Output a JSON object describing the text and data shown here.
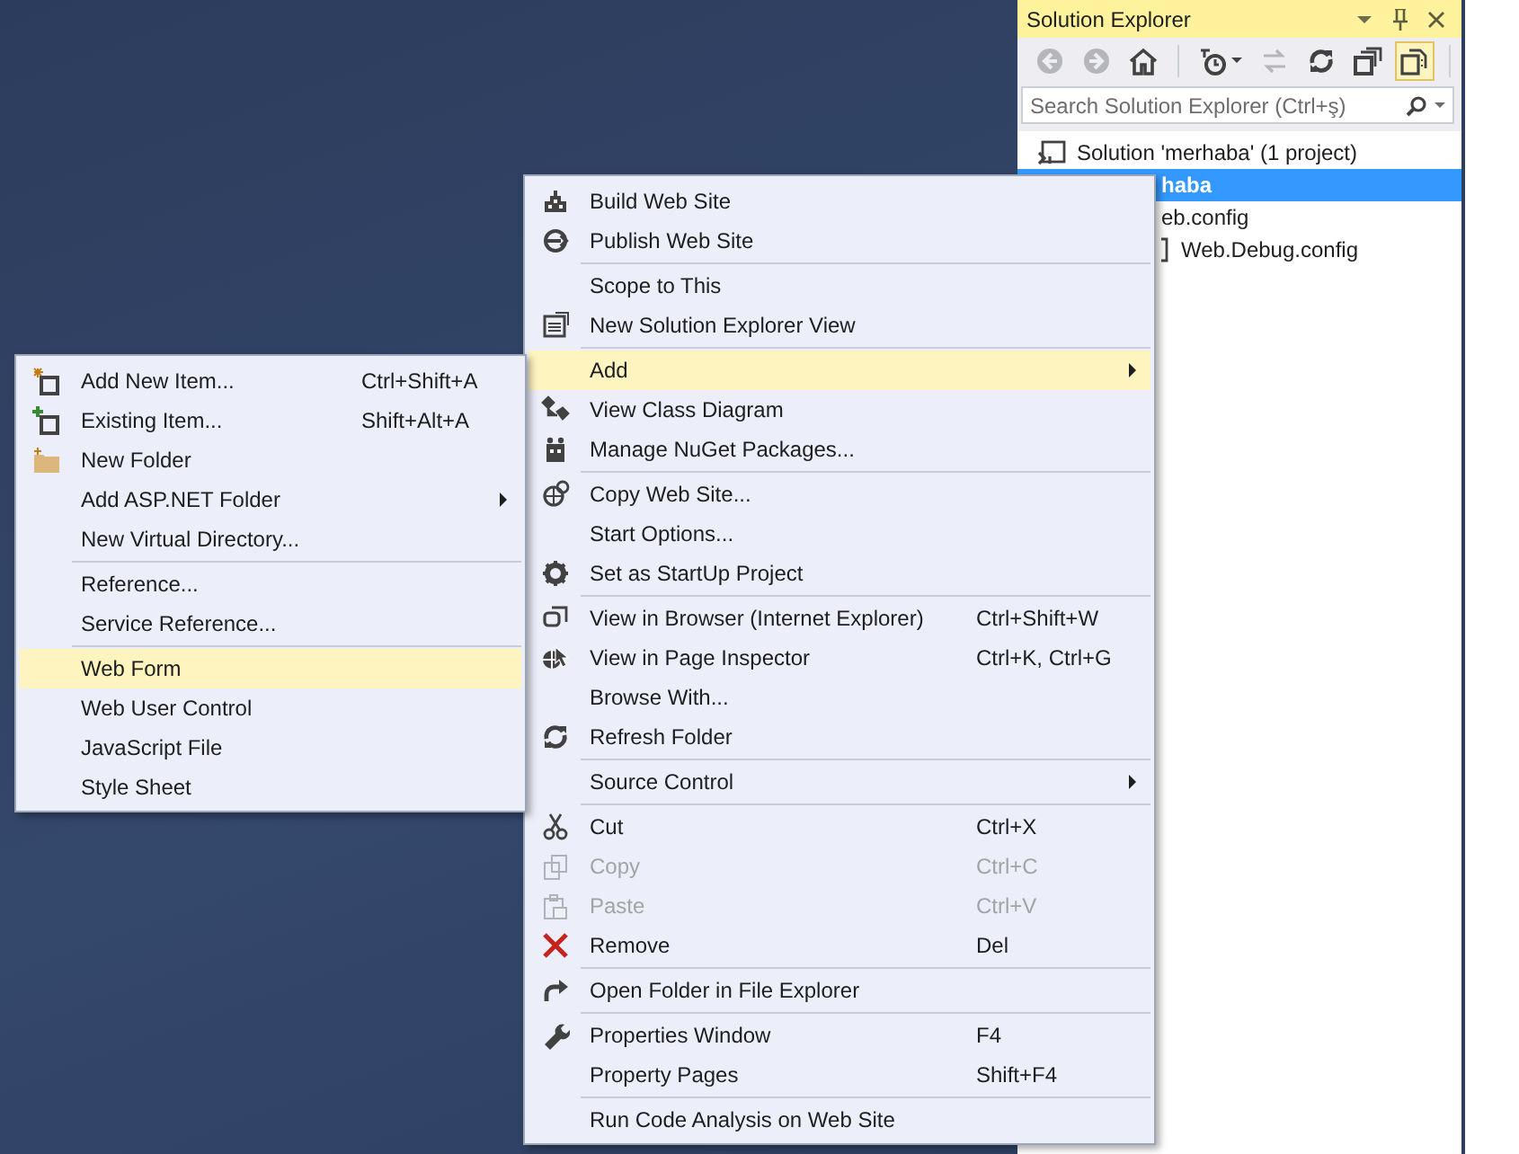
{
  "solution_explorer": {
    "title": "Solution Explorer",
    "toolbar": [
      {
        "disabled": true,
        "pressed": false
      },
      {
        "disabled": true,
        "pressed": false
      },
      {
        "disabled": false,
        "pressed": false
      },
      {
        "disabled": false,
        "pressed": false
      },
      {
        "disabled": true,
        "pressed": false
      },
      {
        "disabled": false,
        "pressed": false
      },
      {
        "disabled": false,
        "pressed": false
      },
      {
        "disabled": false,
        "pressed": true
      }
    ],
    "search": {
      "placeholder": "Search Solution Explorer (Ctrl+ş)"
    },
    "tree": [
      {
        "label": "Solution 'merhaba' (1 project)",
        "selected": false,
        "children": [
          {
            "label": "haba",
            "selected": true,
            "children": [
              {
                "label": "eb.config",
                "selected": false,
                "children": [
                  {
                    "label": "Web.Debug.config",
                    "selected": false
                  }
                ]
              }
            ]
          }
        ]
      }
    ]
  },
  "context_menu": {
    "sections": [
      [
        {
          "label": "Build Web Site",
          "disabled": false,
          "selected": false,
          "has_submenu": false
        },
        {
          "label": "Publish Web Site",
          "disabled": false,
          "selected": false,
          "has_submenu": false
        }
      ],
      [
        {
          "label": "Scope to This",
          "disabled": false,
          "selected": false,
          "has_submenu": false
        },
        {
          "label": "New Solution Explorer View",
          "disabled": false,
          "selected": false,
          "has_submenu": false
        }
      ],
      [
        {
          "label": "Add",
          "disabled": false,
          "selected": true,
          "has_submenu": true
        },
        {
          "label": "View Class Diagram",
          "disabled": false,
          "selected": false,
          "has_submenu": false
        },
        {
          "label": "Manage NuGet Packages...",
          "disabled": false,
          "selected": false,
          "has_submenu": false
        }
      ],
      [
        {
          "label": "Copy Web Site...",
          "disabled": false,
          "selected": false,
          "has_submenu": false
        },
        {
          "label": "Start Options...",
          "disabled": false,
          "selected": false,
          "has_submenu": false
        },
        {
          "label": "Set as StartUp Project",
          "disabled": false,
          "selected": false,
          "has_submenu": false
        }
      ],
      [
        {
          "label": "View in Browser (Internet Explorer)",
          "shortcut": "Ctrl+Shift+W",
          "disabled": false,
          "selected": false,
          "has_submenu": false
        },
        {
          "label": "View in Page Inspector",
          "shortcut": "Ctrl+K, Ctrl+G",
          "disabled": false,
          "selected": false,
          "has_submenu": false
        },
        {
          "label": "Browse With...",
          "disabled": false,
          "selected": false,
          "has_submenu": false
        },
        {
          "label": "Refresh Folder",
          "disabled": false,
          "selected": false,
          "has_submenu": false
        }
      ],
      [
        {
          "label": "Source Control",
          "disabled": false,
          "selected": false,
          "has_submenu": true
        }
      ],
      [
        {
          "label": "Cut",
          "shortcut": "Ctrl+X",
          "disabled": false,
          "selected": false,
          "has_submenu": false
        },
        {
          "label": "Copy",
          "shortcut": "Ctrl+C",
          "disabled": true,
          "selected": false,
          "has_submenu": false
        },
        {
          "label": "Paste",
          "shortcut": "Ctrl+V",
          "disabled": true,
          "selected": false,
          "has_submenu": false
        },
        {
          "label": "Remove",
          "shortcut": "Del",
          "disabled": false,
          "selected": false,
          "has_submenu": false
        }
      ],
      [
        {
          "label": "Open Folder in File Explorer",
          "disabled": false,
          "selected": false,
          "has_submenu": false
        }
      ],
      [
        {
          "label": "Properties Window",
          "shortcut": "F4",
          "disabled": false,
          "selected": false,
          "has_submenu": false
        },
        {
          "label": "Property Pages",
          "shortcut": "Shift+F4",
          "disabled": false,
          "selected": false,
          "has_submenu": false
        }
      ],
      [
        {
          "label": "Run Code Analysis on Web Site",
          "disabled": false,
          "selected": false,
          "has_submenu": false
        }
      ]
    ]
  },
  "add_submenu": {
    "sections": [
      [
        {
          "label": "Add New Item...",
          "shortcut": "Ctrl+Shift+A",
          "disabled": false,
          "selected": false,
          "has_submenu": false
        },
        {
          "label": "Existing Item...",
          "shortcut": "Shift+Alt+A",
          "disabled": false,
          "selected": false,
          "has_submenu": false
        },
        {
          "label": "New Folder",
          "disabled": false,
          "selected": false,
          "has_submenu": false
        },
        {
          "label": "Add ASP.NET Folder",
          "disabled": false,
          "selected": false,
          "has_submenu": true
        },
        {
          "label": "New Virtual Directory...",
          "disabled": false,
          "selected": false,
          "has_submenu": false
        }
      ],
      [
        {
          "label": "Reference...",
          "disabled": false,
          "selected": false,
          "has_submenu": false
        },
        {
          "label": "Service Reference...",
          "disabled": false,
          "selected": false,
          "has_submenu": false
        }
      ],
      [
        {
          "label": "Web Form",
          "disabled": false,
          "selected": true,
          "has_submenu": false
        },
        {
          "label": "Web User Control",
          "disabled": false,
          "selected": false,
          "has_submenu": false
        },
        {
          "label": "JavaScript File",
          "disabled": false,
          "selected": false,
          "has_submenu": false
        },
        {
          "label": "Style Sheet",
          "disabled": false,
          "selected": false,
          "has_submenu": false
        }
      ]
    ]
  }
}
